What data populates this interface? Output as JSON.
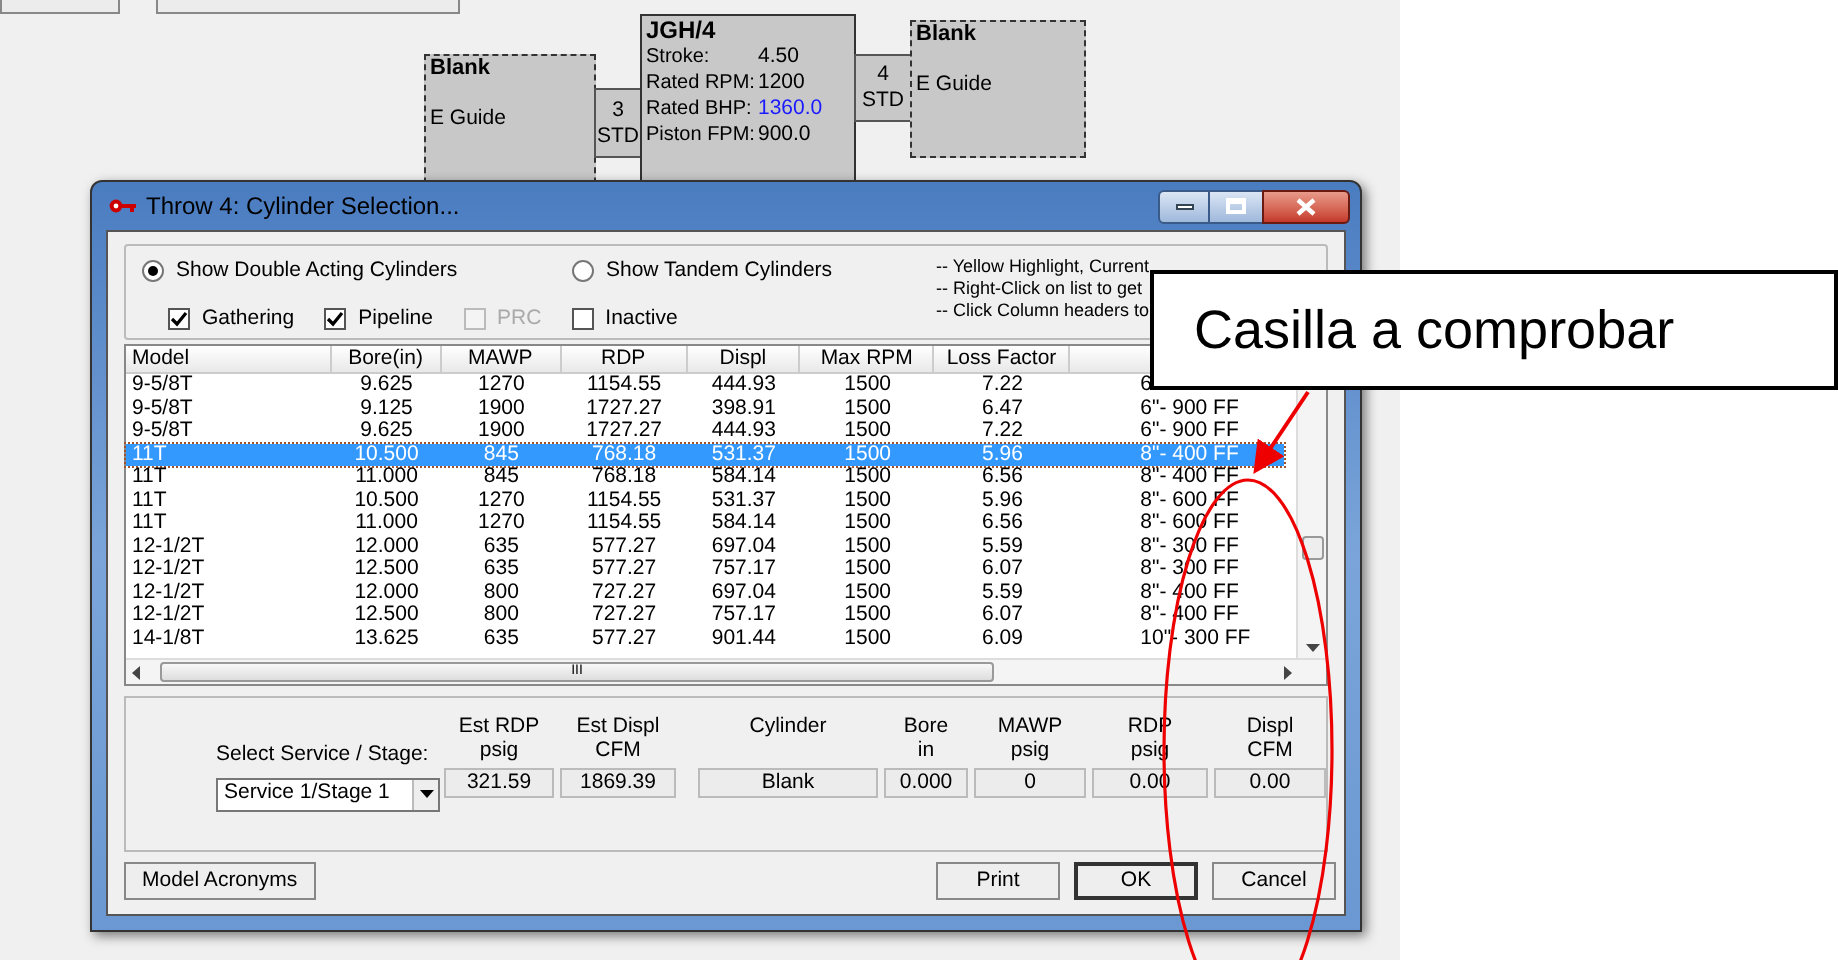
{
  "diagram": {
    "left_node": {
      "title": "Blank",
      "subtitle": "E Guide"
    },
    "left_connector": {
      "number": "3",
      "label": "STD"
    },
    "center_node": {
      "title": "JGH/4",
      "fields": [
        {
          "label": "Stroke:",
          "value": "4.50",
          "emphasized": false
        },
        {
          "label": "Rated RPM:",
          "value": "1200",
          "emphasized": false
        },
        {
          "label": "Rated BHP:",
          "value": "1360.0",
          "emphasized": true
        },
        {
          "label": "Piston FPM:",
          "value": "900.0",
          "emphasized": false
        }
      ]
    },
    "right_connector": {
      "number": "4",
      "label": "STD"
    },
    "right_node": {
      "title": "Blank",
      "subtitle": "E Guide"
    }
  },
  "dialog": {
    "title": "Throw 4:  Cylinder Selection...",
    "radios": [
      {
        "label": "Show Double Acting Cylinders",
        "selected": true
      },
      {
        "label": "Show Tandem Cylinders",
        "selected": false
      }
    ],
    "checkboxes": [
      {
        "label": "Gathering",
        "checked": true,
        "disabled": false
      },
      {
        "label": "Pipeline",
        "checked": true,
        "disabled": false
      },
      {
        "label": "PRC",
        "checked": false,
        "disabled": true
      },
      {
        "label": "Inactive",
        "checked": false,
        "disabled": false
      }
    ],
    "notes": [
      "-- Yellow Highlight, Current",
      "-- Right-Click on list to get",
      "-- Click Column headers to"
    ],
    "table": {
      "columns": [
        "Model",
        "Bore(in)",
        "MAWP",
        "RDP",
        "Displ",
        "Max RPM",
        "Loss Factor"
      ],
      "rows": [
        {
          "cells": [
            "9-5/8T",
            "9.625",
            "1270",
            "1154.55",
            "444.93",
            "1500",
            "7.22",
            "6"
          ],
          "selected": false
        },
        {
          "cells": [
            "9-5/8T",
            "9.125",
            "1900",
            "1727.27",
            "398.91",
            "1500",
            "6.47",
            "6\"- 900  FF"
          ],
          "selected": false
        },
        {
          "cells": [
            "9-5/8T",
            "9.625",
            "1900",
            "1727.27",
            "444.93",
            "1500",
            "7.22",
            "6\"- 900  FF"
          ],
          "selected": false
        },
        {
          "cells": [
            "11T",
            "10.500",
            "845",
            "768.18",
            "531.37",
            "1500",
            "5.96",
            "8\"- 400  FF"
          ],
          "selected": true
        },
        {
          "cells": [
            "11T",
            "11.000",
            "845",
            "768.18",
            "584.14",
            "1500",
            "6.56",
            "8\"- 400  FF"
          ],
          "selected": false
        },
        {
          "cells": [
            "11T",
            "10.500",
            "1270",
            "1154.55",
            "531.37",
            "1500",
            "5.96",
            "8\"- 600  FF"
          ],
          "selected": false
        },
        {
          "cells": [
            "11T",
            "11.000",
            "1270",
            "1154.55",
            "584.14",
            "1500",
            "6.56",
            "8\"- 600  FF"
          ],
          "selected": false
        },
        {
          "cells": [
            "12-1/2T",
            "12.000",
            "635",
            "577.27",
            "697.04",
            "1500",
            "5.59",
            "8\"- 300  FF"
          ],
          "selected": false
        },
        {
          "cells": [
            "12-1/2T",
            "12.500",
            "635",
            "577.27",
            "757.17",
            "1500",
            "6.07",
            "8\"- 300  FF"
          ],
          "selected": false
        },
        {
          "cells": [
            "12-1/2T",
            "12.000",
            "800",
            "727.27",
            "697.04",
            "1500",
            "5.59",
            "8\"- 400  FF"
          ],
          "selected": false
        },
        {
          "cells": [
            "12-1/2T",
            "12.500",
            "800",
            "727.27",
            "757.17",
            "1500",
            "6.07",
            "8\"- 400  FF"
          ],
          "selected": false
        },
        {
          "cells": [
            "14-1/8T",
            "13.625",
            "635",
            "577.27",
            "901.44",
            "1500",
            "6.09",
            "10\"- 300  FF"
          ],
          "selected": false
        }
      ],
      "scroll_glyph": "III"
    },
    "service_label": "Select Service / Stage:",
    "service_select": "Service 1/Stage 1",
    "fields": [
      {
        "label": [
          "Est RDP",
          "psig"
        ],
        "value": "321.59"
      },
      {
        "label": [
          "Est Displ",
          "CFM"
        ],
        "value": "1869.39"
      },
      {
        "label": [
          "Cylinder"
        ],
        "value": "Blank"
      },
      {
        "label": [
          "Bore",
          "in"
        ],
        "value": "0.000"
      },
      {
        "label": [
          "MAWP",
          "psig"
        ],
        "value": "0"
      },
      {
        "label": [
          "RDP",
          "psig"
        ],
        "value": "0.00"
      },
      {
        "label": [
          "Displ",
          "CFM"
        ],
        "value": "0.00"
      }
    ],
    "left_button": "Model Acronyms",
    "buttons": [
      {
        "label": "Print",
        "default": false
      },
      {
        "label": "OK",
        "default": true
      },
      {
        "label": "Cancel",
        "default": false
      }
    ]
  },
  "callout": {
    "text": "Casilla a comprobar"
  }
}
